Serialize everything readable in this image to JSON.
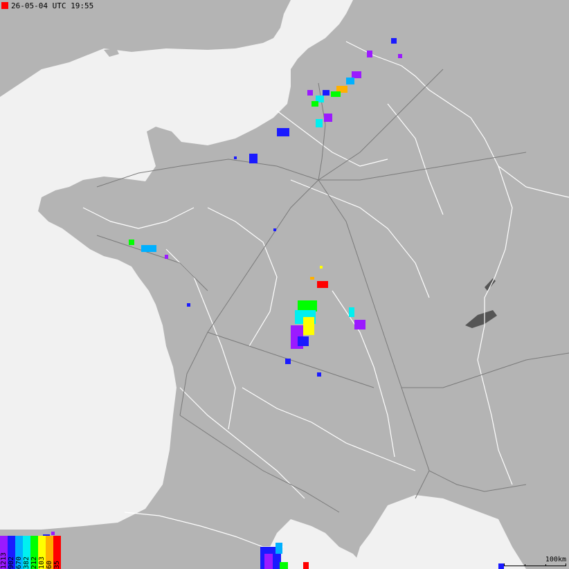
{
  "header": {
    "timestamp": "26-05-04 UTC 19:55"
  },
  "legend": {
    "title_missing": "",
    "classes": [
      {
        "value": "1213",
        "color": "#9b1aff"
      },
      {
        "value": "902",
        "color": "#1a1aff"
      },
      {
        "value": "670",
        "color": "#00b0ff"
      },
      {
        "value": "382",
        "color": "#00f0f0"
      },
      {
        "value": "212",
        "color": "#00ff00"
      },
      {
        "value": "103",
        "color": "#ffff00"
      },
      {
        "value": "60",
        "color": "#ffb000"
      },
      {
        "value": "35",
        "color": "#ff0000"
      }
    ]
  },
  "scale_bar": {
    "label": "100km"
  },
  "map": {
    "sea_color": "#f1f1f1",
    "land_color": "#b4b4b4",
    "land_dark_color": "#8c8c8c",
    "border_color": "#ffffff",
    "road_color": "#6e6e6e"
  }
}
